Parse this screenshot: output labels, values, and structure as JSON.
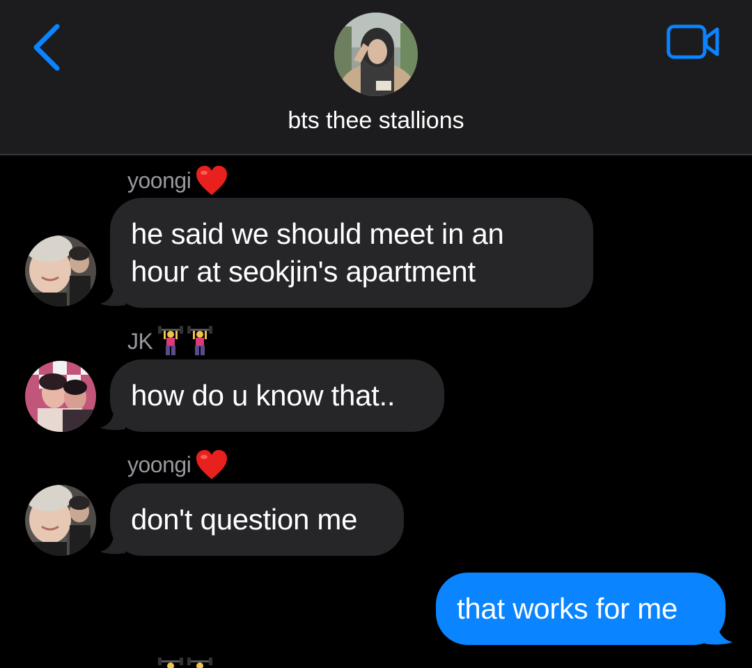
{
  "header": {
    "title": "bts thee stallions",
    "back_icon": "chevron-left-icon",
    "video_icon": "video-camera-icon",
    "accent": "#0a84ff"
  },
  "messages": [
    {
      "sender": "yoongi",
      "sender_emoji": "❤️",
      "lines": [
        "he said we should meet in an",
        "hour at seokjin's apartment"
      ],
      "direction": "incoming"
    },
    {
      "sender": "JK",
      "sender_emoji": "🏋️‍♀️🏋️‍♀️",
      "lines": [
        "how do u know that.."
      ],
      "direction": "incoming"
    },
    {
      "sender": "yoongi",
      "sender_emoji": "❤️",
      "lines": [
        "don't question me"
      ],
      "direction": "incoming"
    },
    {
      "sender": "",
      "lines": [
        "that works for me"
      ],
      "direction": "outgoing"
    }
  ],
  "colors": {
    "incoming_bubble": "#262629",
    "outgoing_bubble": "#0a84ff",
    "header_bg": "#1c1c1e",
    "sender_text": "#98989f"
  }
}
